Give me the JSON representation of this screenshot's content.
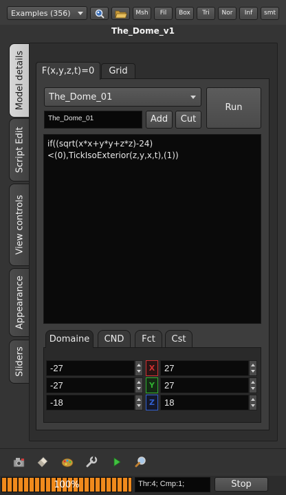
{
  "toolbar": {
    "examples_label": "Examples (356)",
    "buttons": [
      "Msh",
      "Fil",
      "Box",
      "Tri",
      "Nor",
      "Inf",
      "smt"
    ]
  },
  "window_title": "The_Dome_v1",
  "side_tabs": [
    "Model details",
    "Script Edit",
    "View controls",
    "Appearance",
    "Sliders"
  ],
  "model": {
    "tabs": [
      "F(x,y,z,t)=0",
      "Grid"
    ],
    "selected_model": "The_Dome_01",
    "name_value": "The_Dome_01",
    "add_label": "Add",
    "cut_label": "Cut",
    "run_label": "Run",
    "script": "if((sqrt(x*x+y*y+z*z)-24)<(0),TickIsoExterior(z,y,x,t),(1))"
  },
  "sub_tabs": [
    "Domaine",
    "CND",
    "Fct",
    "Cst"
  ],
  "domain": {
    "rows": [
      {
        "axis": "X",
        "min": "-27",
        "max": "27"
      },
      {
        "axis": "Y",
        "min": "-27",
        "max": "27"
      },
      {
        "axis": "Z",
        "min": "-18",
        "max": "18"
      }
    ]
  },
  "colors": {
    "axis_x": "#d03030",
    "axis_y": "#30b030",
    "axis_z": "#3060d0",
    "progress": "#f08a1c"
  },
  "status": {
    "progress_percent": 100,
    "progress_label": "100%",
    "thread_info": "Thr:4; Cmp:1;",
    "stop_label": "Stop"
  },
  "bottom_icons": [
    "camera-icon",
    "eraser-icon",
    "palette-icon",
    "wrench-icon",
    "play-icon",
    "magnifier-icon"
  ]
}
